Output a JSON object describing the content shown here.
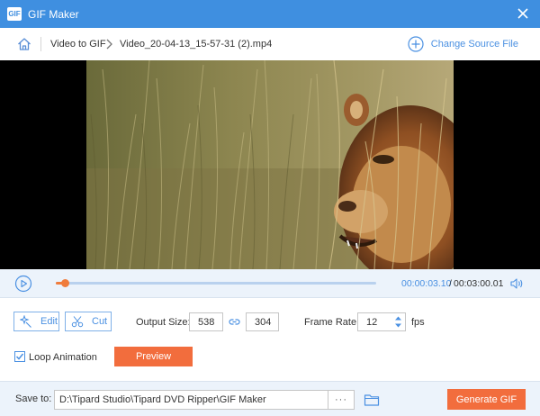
{
  "window": {
    "title": "GIF Maker",
    "app_icon_glyph": "GIF",
    "accent_color": "#3f8fe0"
  },
  "nav": {
    "breadcrumb_root": "Video to GIF",
    "breadcrumb_file": "Video_20-04-13_15-57-31 (2).mp4",
    "change_source_label": "Change Source File"
  },
  "player": {
    "current_time": "00:00:03.10",
    "separator": "/",
    "total_time": "00:03:00.01",
    "progress_fraction": 0.028
  },
  "controls": {
    "edit_label": "Edit",
    "cut_label": "Cut",
    "output_size_label": "Output Size:",
    "width_value": "538",
    "height_value": "304",
    "frame_rate_label": "Frame Rate:",
    "frame_rate_value": "12",
    "fps_label": "fps",
    "loop_label": "Loop Animation",
    "loop_checked": true,
    "preview_label": "Preview"
  },
  "bottom": {
    "save_to_label": "Save to:",
    "save_path": "D:\\Tipard Studio\\Tipard DVD Ripper\\GIF Maker",
    "more_label": "···",
    "generate_label": "Generate GIF"
  },
  "colors": {
    "primary_orange": "#f26d3d",
    "link_blue": "#4a90e2"
  }
}
